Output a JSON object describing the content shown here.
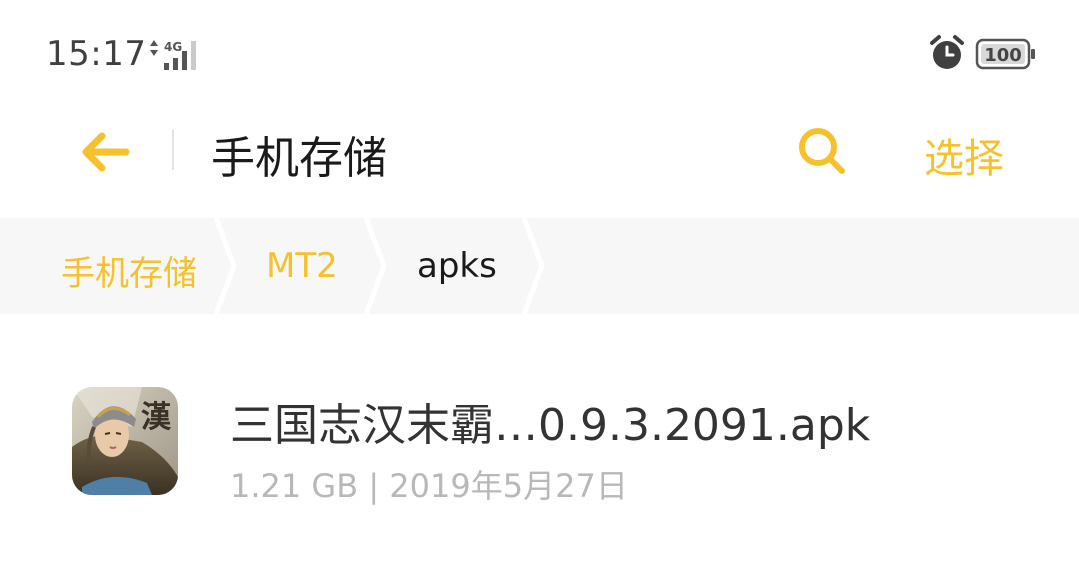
{
  "status_bar": {
    "time": "15:17",
    "network": "4G",
    "battery": "100"
  },
  "header": {
    "title": "手机存储",
    "select_label": "选择"
  },
  "breadcrumb": {
    "items": [
      {
        "label": "手机存储",
        "state": "link"
      },
      {
        "label": "MT2",
        "state": "link"
      },
      {
        "label": "apks",
        "state": "current"
      }
    ]
  },
  "files": [
    {
      "name": "三国志汉末霸…0.9.3.2091.apk",
      "meta": "1.21 GB | 2019年5月27日",
      "icon_glyph": "漢",
      "icon": "game-app-icon"
    }
  ],
  "colors": {
    "accent": "#f5c22d",
    "title_text": "#1a1a1a",
    "secondary_text": "#b8b8b8",
    "breadcrumb_bg": "#f7f7f7"
  }
}
